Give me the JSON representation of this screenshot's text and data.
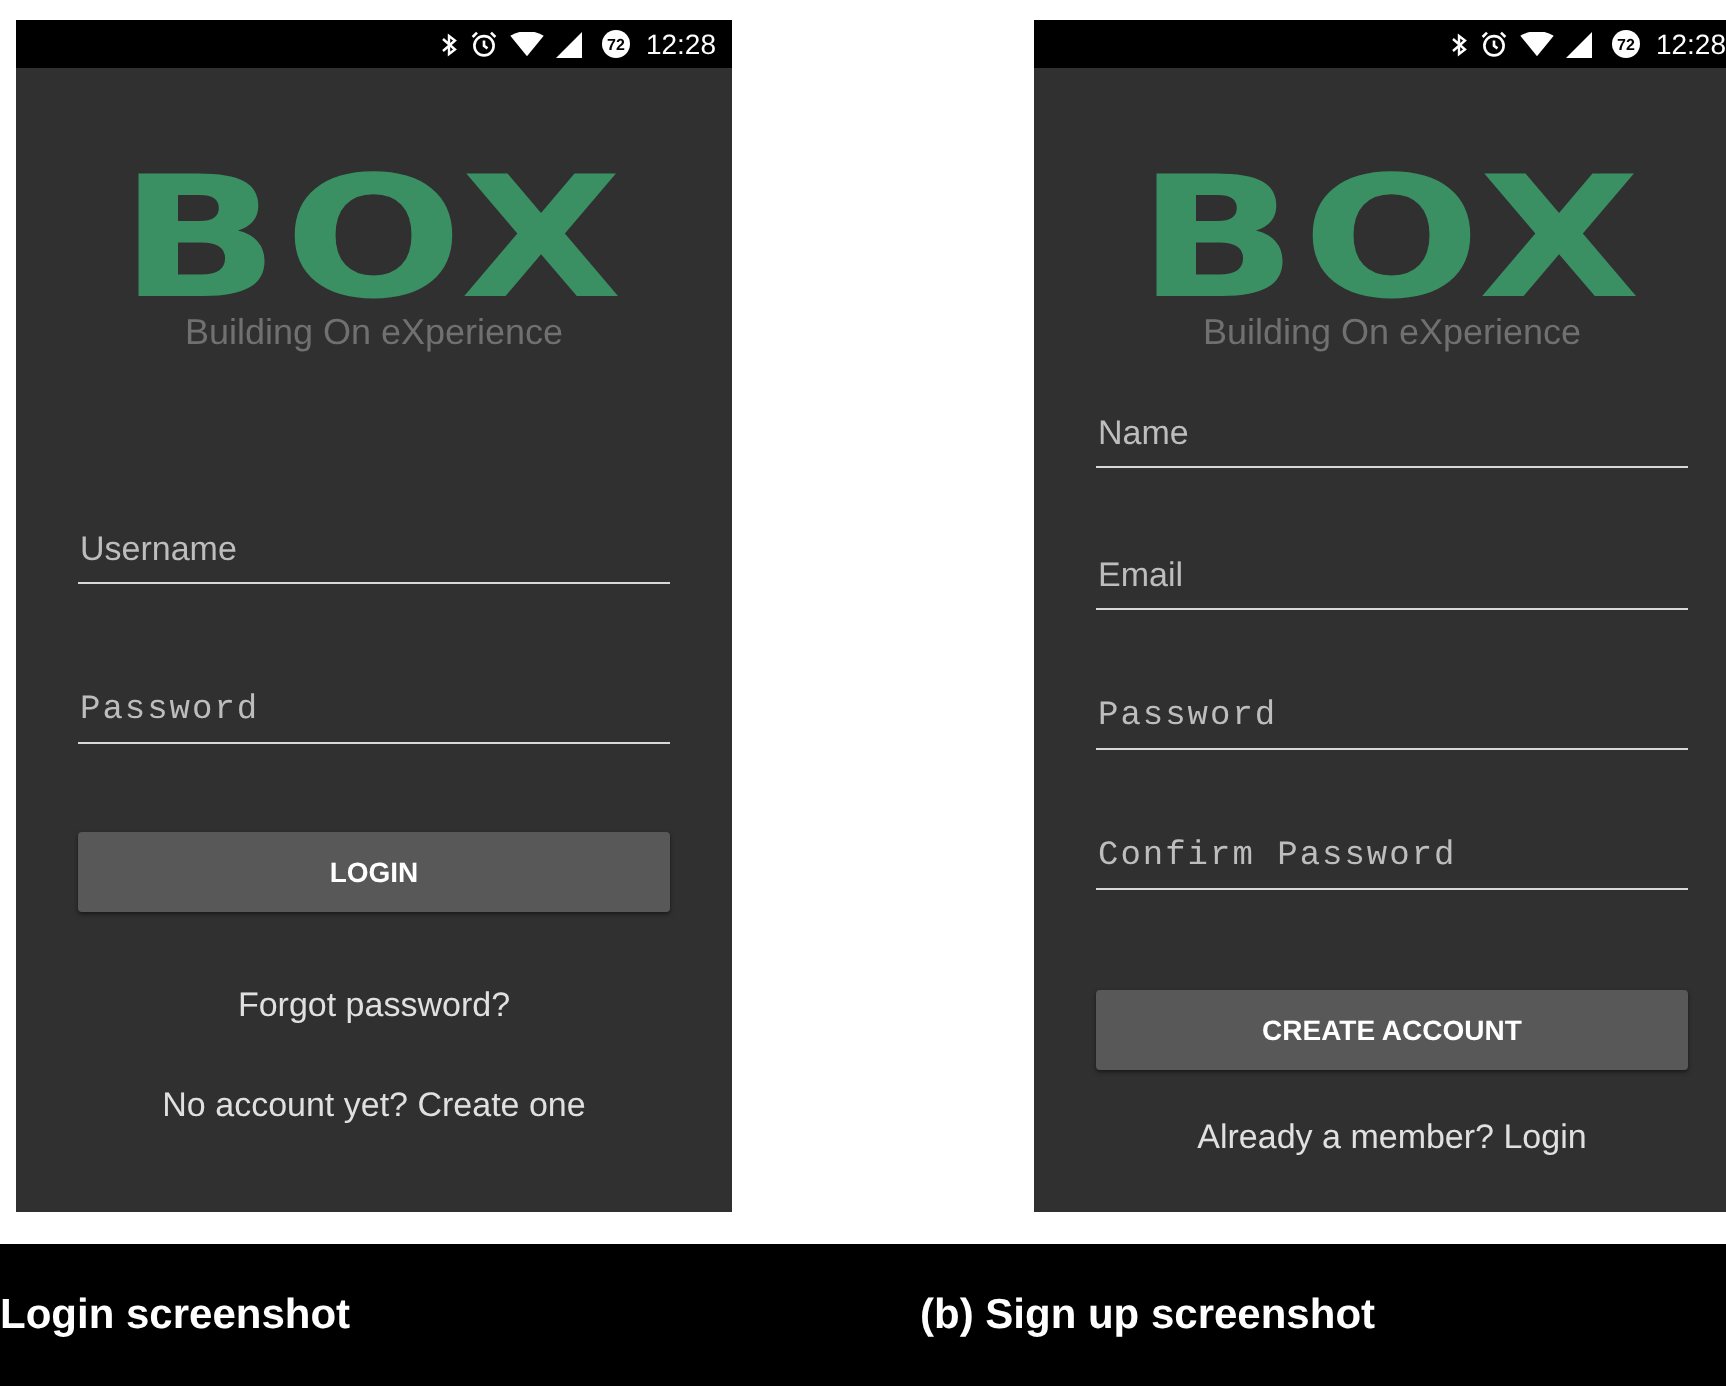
{
  "screens": [
    {
      "status": {
        "battery": "72",
        "time": "12:28"
      },
      "logo": "BOX",
      "tagline": "Building On eXperience",
      "fields": [
        {
          "placeholder": "Username",
          "kind": "text"
        },
        {
          "placeholder": "Password",
          "kind": "password"
        }
      ],
      "button": "LOGIN",
      "links": [
        "Forgot password?",
        "No account yet? Create one"
      ],
      "kind": "login"
    },
    {
      "status": {
        "battery": "72",
        "time": "12:28"
      },
      "logo": "BOX",
      "tagline": "Building On eXperience",
      "fields": [
        {
          "placeholder": "Name",
          "kind": "text"
        },
        {
          "placeholder": "Email",
          "kind": "text"
        },
        {
          "placeholder": "Password",
          "kind": "password"
        },
        {
          "placeholder": "Confirm Password",
          "kind": "password"
        }
      ],
      "button": "CREATE ACCOUNT",
      "links": [
        "Already a member? Login"
      ],
      "kind": "signup"
    }
  ],
  "captions": [
    "Login screenshot",
    "(b) Sign up screenshot"
  ]
}
